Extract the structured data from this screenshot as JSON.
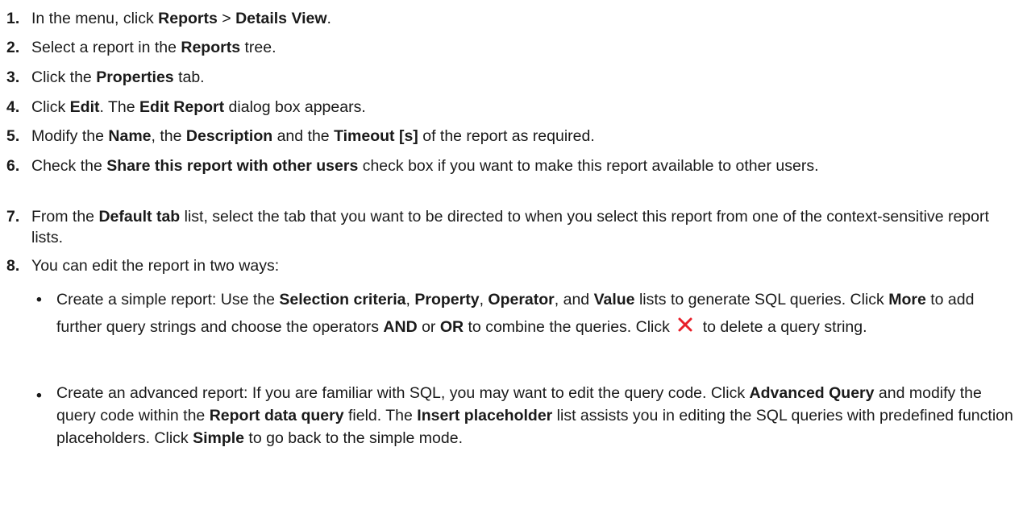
{
  "steps": [
    {
      "num": "1.",
      "parts": [
        "In the menu, click ",
        "Reports",
        " > ",
        "Details View",
        "."
      ]
    },
    {
      "num": "2.",
      "parts": [
        "Select a report in the ",
        "Reports",
        " tree."
      ]
    },
    {
      "num": "3.",
      "parts": [
        "Click the ",
        "Properties",
        " tab."
      ]
    },
    {
      "num": "4.",
      "parts": [
        "Click ",
        "Edit",
        ". The ",
        "Edit Report",
        " dialog box appears."
      ]
    },
    {
      "num": "5.",
      "parts": [
        "Modify the ",
        "Name",
        ", the ",
        "Description",
        " and the ",
        "Timeout [s]",
        " of the report as required."
      ]
    },
    {
      "num": "6.",
      "parts": [
        "Check the ",
        "Share this report with other users",
        " check box if you want to make this report available to other users."
      ]
    },
    {
      "num": "7.",
      "parts": [
        "From the ",
        "Default tab",
        " list, select the tab that you want to be directed to when you select this report from one of the context-sensitive report lists."
      ]
    },
    {
      "num": "8.",
      "parts": [
        "You can edit the report in two ways:"
      ]
    }
  ],
  "bullets": [
    {
      "symbol": "•",
      "parts": [
        "Create a simple report: Use the ",
        "Selection criteria",
        ", ",
        "Property",
        ", ",
        "Operator",
        ", and ",
        "Value",
        " lists to generate SQL queries. Click ",
        "More",
        " to add further query strings and choose the operators ",
        "AND",
        " or ",
        "OR",
        " to combine the queries. Click ",
        "",
        " to delete a query string."
      ]
    },
    {
      "symbol": "•",
      "parts": [
        "Create an advanced report: If you are familiar with SQL, you may want to edit the query code. Click ",
        "Advanced Query",
        " and modify the query code within the ",
        "Report data query",
        " field. The ",
        "Insert placeholder",
        " list assists you in editing the SQL queries with predefined function placeholders. Click ",
        "Simple",
        " to go back to the simple mode."
      ]
    }
  ],
  "icons": {
    "delete": "delete-x-icon",
    "delete_color": "#e8202a"
  }
}
